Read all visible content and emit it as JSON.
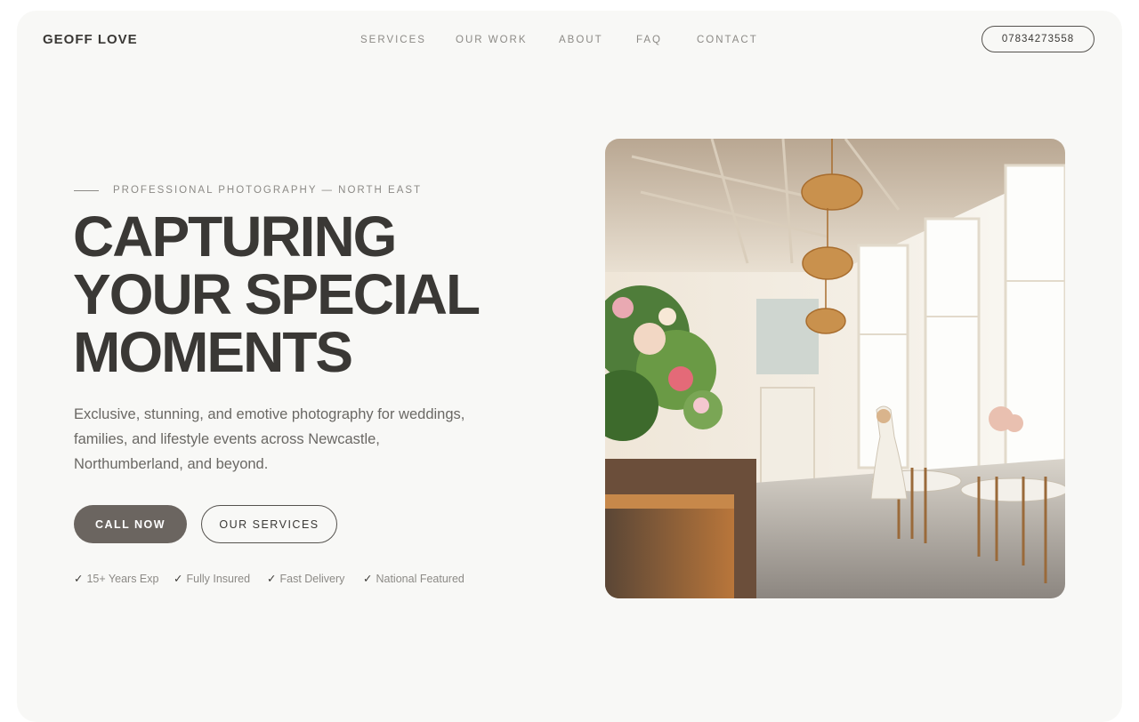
{
  "brand": "GEOFF LOVE",
  "nav": {
    "items": [
      "SERVICES",
      "OUR WORK",
      "ABOUT",
      "FAQ",
      "CONTACT"
    ]
  },
  "phone": "07834273558",
  "hero": {
    "eyebrow": "PROFESSIONAL PHOTOGRAPHY — NORTH EAST",
    "headline": [
      "CAPTURING",
      "YOUR SPECIAL",
      "MOMENTS"
    ],
    "description": "Exclusive, stunning, and emotive photography for weddings, families, and lifestyle events across Newcastle, Northumberland, and beyond.",
    "cta_primary": "CALL NOW",
    "cta_secondary": "OUR SERVICES",
    "check_glyph": "✓",
    "features": [
      "15+ Years Exp",
      "Fully Insured",
      "Fast Delivery",
      "National Featured"
    ]
  },
  "colors": {
    "page_background": "#f8f8f6",
    "text_dark": "#3a3835",
    "text_muted": "#8c8a86",
    "primary_button": "#6b6560"
  },
  "image": {
    "subject": "wedding-venue-photo"
  }
}
